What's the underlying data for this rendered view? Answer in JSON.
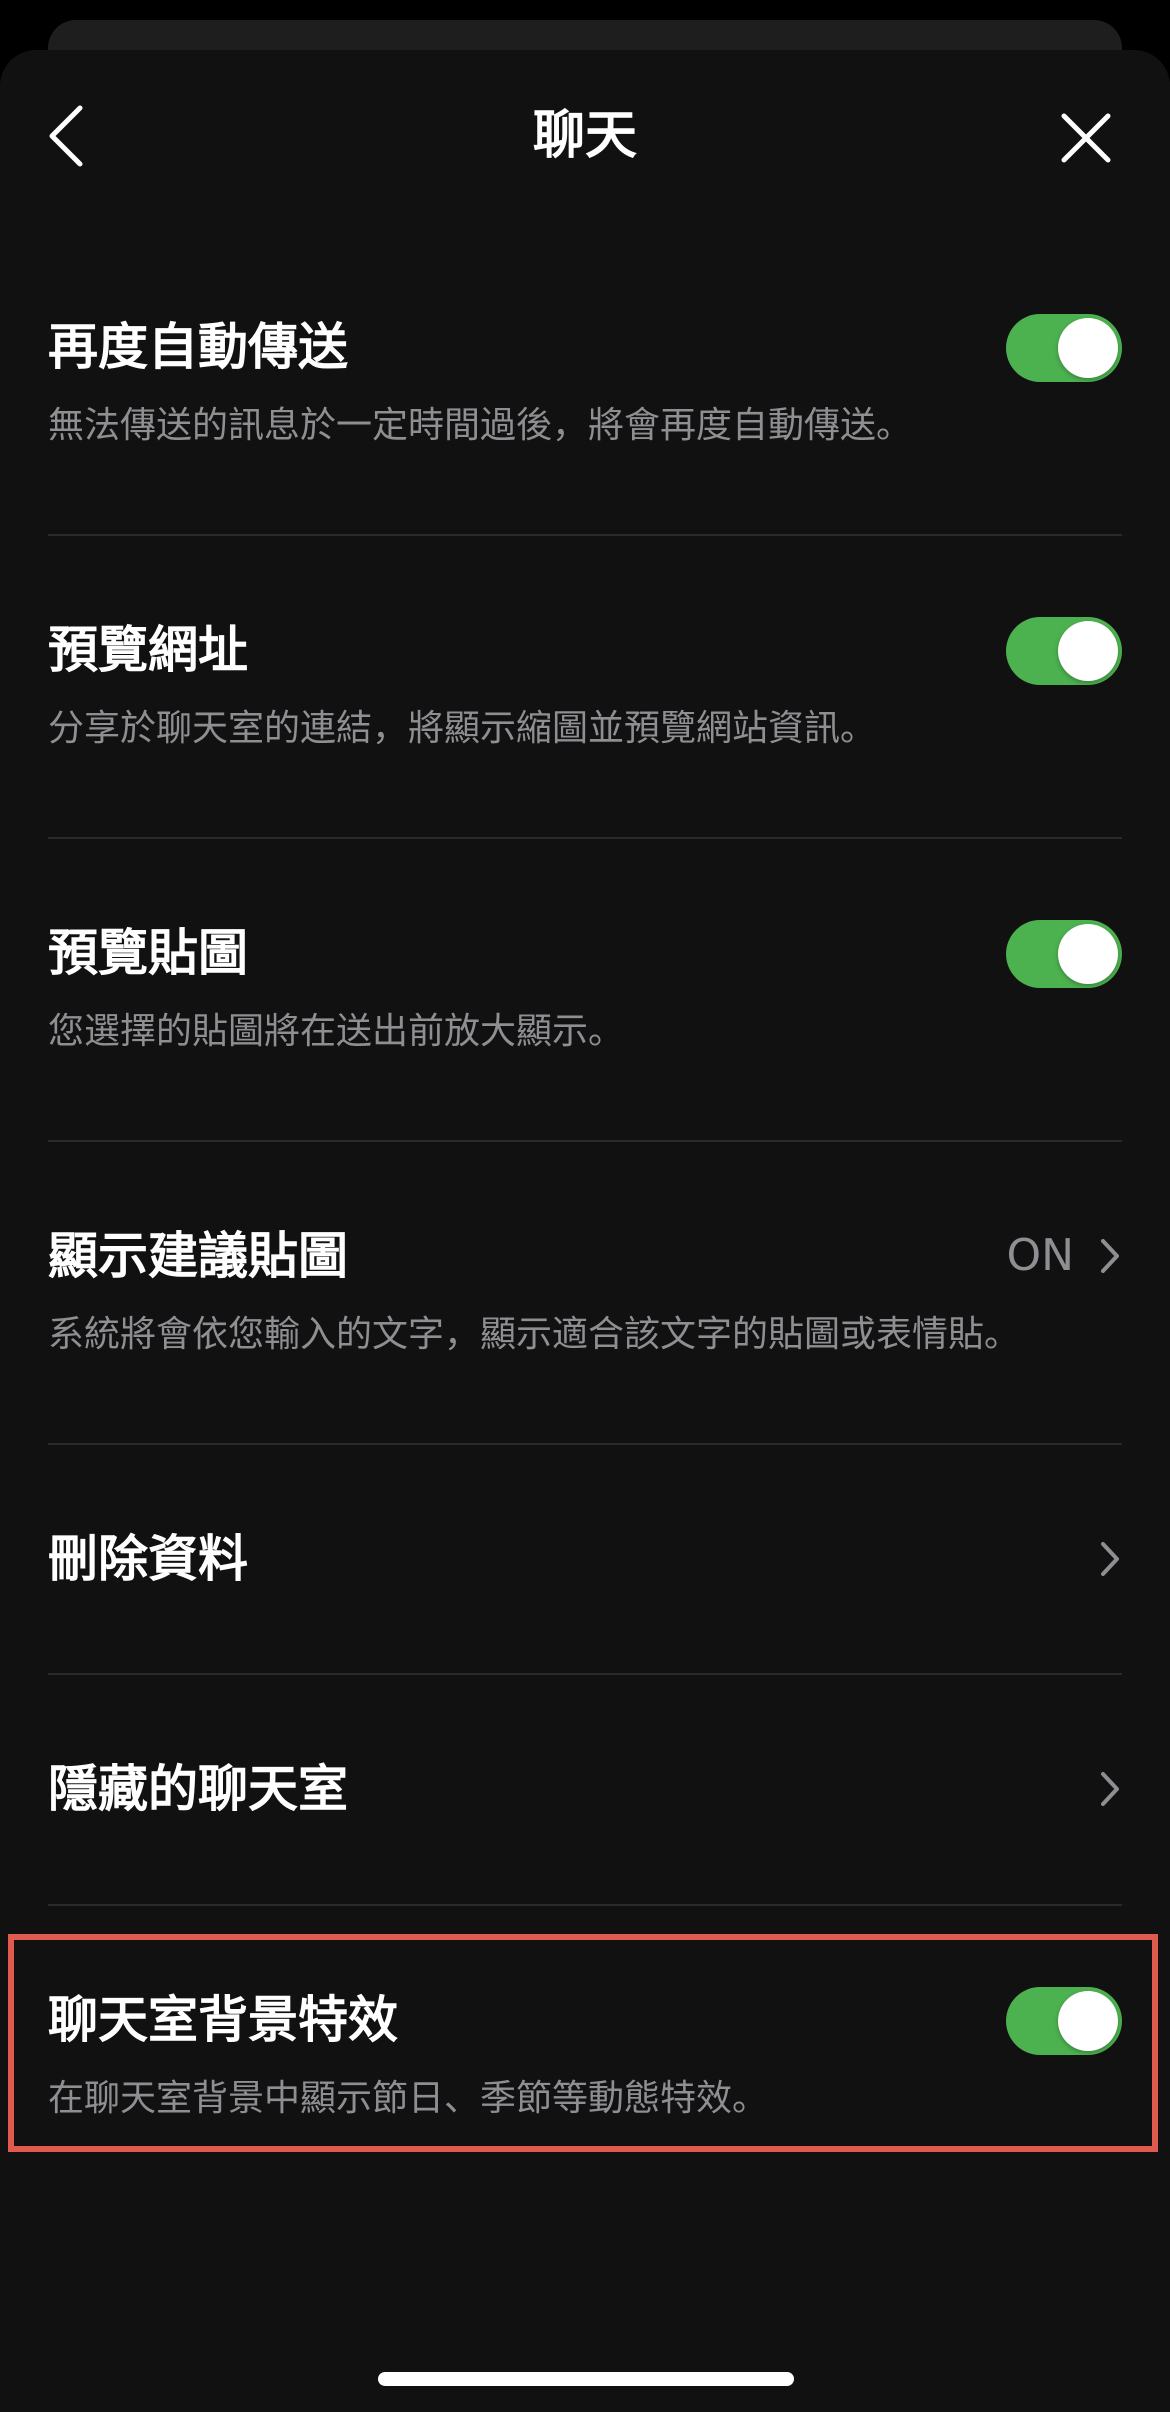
{
  "header": {
    "title": "聊天"
  },
  "settings": {
    "auto_resend": {
      "title": "再度自動傳送",
      "description": "無法傳送的訊息於一定時間過後，將會再度自動傳送。",
      "enabled": true
    },
    "preview_url": {
      "title": "預覽網址",
      "description": "分享於聊天室的連結，將顯示縮圖並預覽網站資訊。",
      "enabled": true
    },
    "preview_sticker": {
      "title": "預覽貼圖",
      "description": "您選擇的貼圖將在送出前放大顯示。",
      "enabled": true
    },
    "suggested_stickers": {
      "title": "顯示建議貼圖",
      "description": "系統將會依您輸入的文字，顯示適合該文字的貼圖或表情貼。",
      "value": "ON"
    },
    "delete_data": {
      "title": "刪除資料"
    },
    "hidden_chats": {
      "title": "隱藏的聊天室"
    },
    "background_effects": {
      "title": "聊天室背景特效",
      "description": "在聊天室背景中顯示節日、季節等動態特效。",
      "enabled": true
    }
  },
  "colors": {
    "background": "#111111",
    "toggle_on": "#4cb14f",
    "secondary_text": "#8e8e93",
    "highlight": "#e05a4d"
  },
  "icons": {
    "back": "chevron-left-icon",
    "close": "close-icon",
    "disclosure": "chevron-right-icon"
  }
}
